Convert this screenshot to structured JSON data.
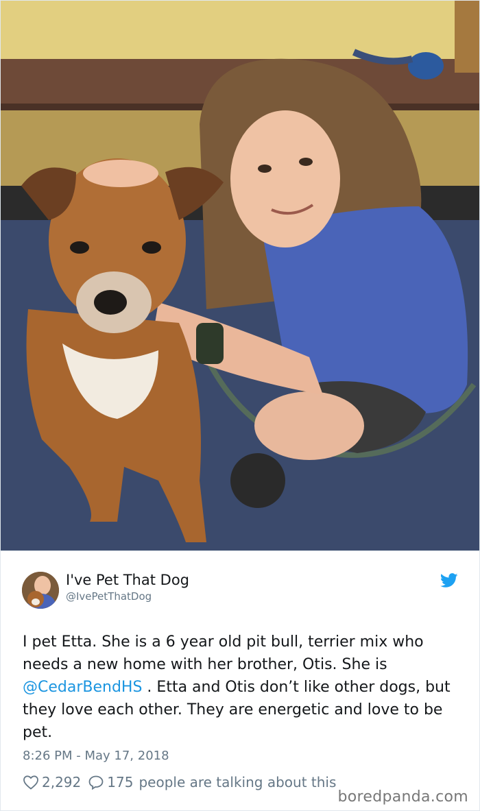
{
  "photo": {
    "description_icon": "photo-girl-with-dog"
  },
  "tweet": {
    "author_name": "I've Pet That Dog",
    "author_handle": "@IvePetThatDog",
    "text_before": "I pet Etta. She is a 6 year old pit bull, terrier mix who needs a new home with her brother, Otis. She is ",
    "mention": "@CedarBendHS",
    "text_after": " . Etta and Otis don’t like other dogs, but they love each other. They are energetic and love to be pet.",
    "timestamp": "8:26 PM - May 17, 2018",
    "likes": "2,292",
    "replies": "175",
    "talking_text": "people are talking about this"
  },
  "watermark": "boredpanda.com",
  "colors": {
    "link": "#1b95e0",
    "muted": "#657786",
    "text": "#14171a",
    "twitter_blue": "#1da1f2"
  }
}
